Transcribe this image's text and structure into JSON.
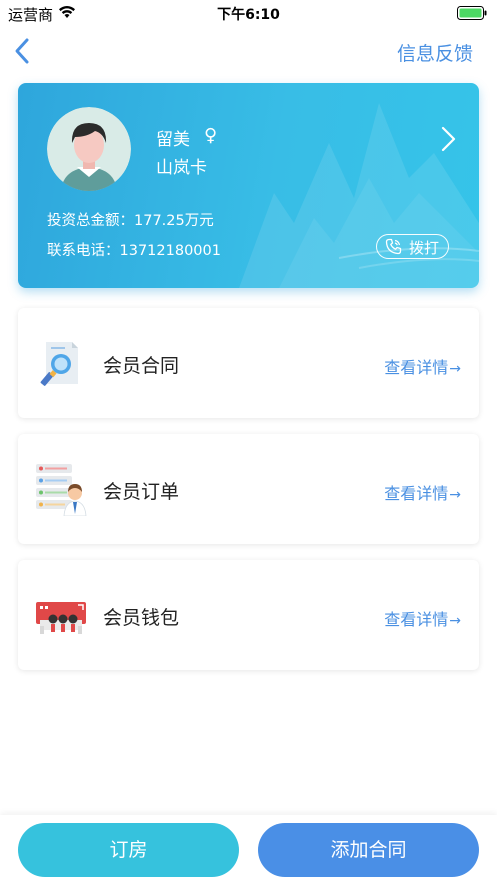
{
  "status_bar": {
    "carrier": "运营商",
    "time": "下午6:10"
  },
  "nav": {
    "feedback_label": "信息反馈"
  },
  "member": {
    "name": "留美",
    "gender_symbol": "♀",
    "card_type": "山岚卡",
    "invest_label": "投资总金额：",
    "invest_value": "177.25万元",
    "phone_label": "联系电话：",
    "phone_value": "13712180001",
    "call_label": "拨打"
  },
  "items": [
    {
      "title": "会员合同",
      "detail": "查看详情",
      "icon": "contract-icon"
    },
    {
      "title": "会员订单",
      "detail": "查看详情",
      "icon": "order-icon"
    },
    {
      "title": "会员钱包",
      "detail": "查看详情",
      "icon": "wallet-icon"
    }
  ],
  "bottom": {
    "book_label": "订房",
    "add_contract_label": "添加合同"
  },
  "colors": {
    "accent": "#4a90e2",
    "card_gradient_start": "#2ea6dc",
    "card_gradient_end": "#35c4e9",
    "book_button": "#36c2dd",
    "add_button": "#4a8fe6"
  }
}
